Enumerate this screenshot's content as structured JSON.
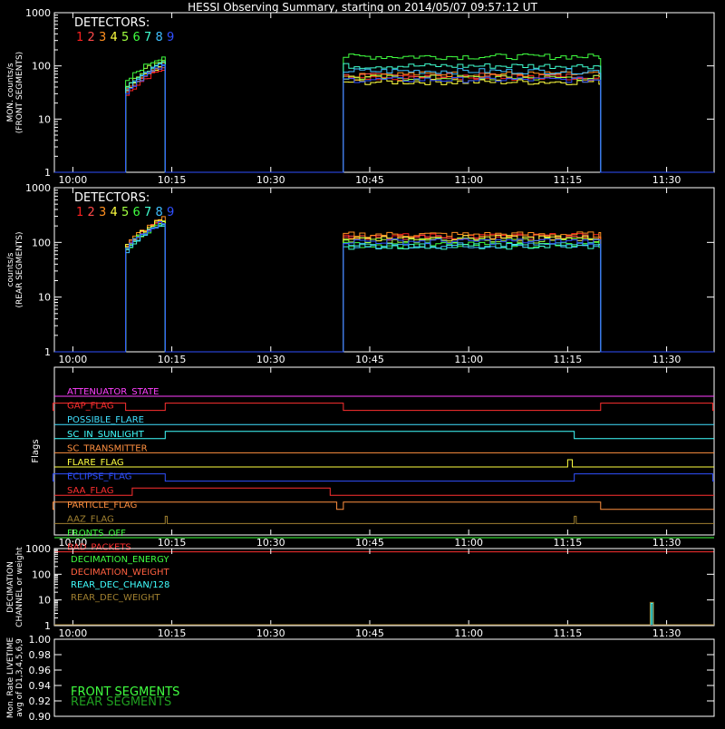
{
  "title": "HESSI Observing Summary, starting on 2014/05/07 09:57:12 UT",
  "colors": {
    "background": "#000000",
    "axes": "#ffffff",
    "det1": "#ff2020",
    "det2": "#ff4a4a",
    "det3": "#ff9020",
    "det4": "#ffff40",
    "det5": "#a0ff40",
    "det6": "#40ff40",
    "det7": "#40ffd0",
    "det8": "#40c0ff",
    "det9": "#3050ff"
  },
  "chart_data": [
    {
      "type": "line",
      "panel": "front",
      "ylabel": "MON. counts/s\n(FRONT SEGMENTS)",
      "yscale": "log",
      "ylim": [
        1,
        1000
      ],
      "yticks": [
        "1",
        "10",
        "100",
        "1000"
      ],
      "xticks": [
        "10:00",
        "10:15",
        "10:30",
        "10:45",
        "11:00",
        "11:15",
        "11:30"
      ],
      "legend_title": "DETECTORS:",
      "legend": [
        "1",
        "2",
        "3",
        "4",
        "5",
        "6",
        "7",
        "8",
        "9"
      ],
      "obs_windows": [
        [
          "10:08",
          "10:14"
        ],
        [
          "10:41",
          "11:20"
        ]
      ],
      "series": [
        {
          "name": "1",
          "color": "#ff2020",
          "levels": [
            40,
            60
          ]
        },
        {
          "name": "2",
          "color": "#ff4a4a",
          "levels": [
            45,
            65
          ]
        },
        {
          "name": "3",
          "color": "#ff9020",
          "levels": [
            50,
            70
          ]
        },
        {
          "name": "4",
          "color": "#ffff40",
          "levels": [
            45,
            50
          ]
        },
        {
          "name": "5",
          "color": "#a0ff40",
          "levels": [
            60,
            60
          ]
        },
        {
          "name": "6",
          "color": "#40ff40",
          "levels": [
            70,
            150
          ]
        },
        {
          "name": "7",
          "color": "#40ffd0",
          "levels": [
            55,
            100
          ]
        },
        {
          "name": "8",
          "color": "#40c0ff",
          "levels": [
            50,
            80
          ]
        },
        {
          "name": "9",
          "color": "#3050ff",
          "levels": [
            45,
            55
          ]
        }
      ]
    },
    {
      "type": "line",
      "panel": "rear",
      "ylabel": "counts/s\n(REAR SEGMENTS)",
      "yscale": "log",
      "ylim": [
        1,
        1000
      ],
      "yticks": [
        "1",
        "10",
        "100",
        "1000"
      ],
      "xticks": [
        "10:00",
        "10:15",
        "10:30",
        "10:45",
        "11:00",
        "11:15",
        "11:30"
      ],
      "legend_title": "DETECTORS:",
      "legend": [
        "1",
        "2",
        "3",
        "4",
        "5",
        "6",
        "7",
        "8",
        "9"
      ],
      "obs_windows": [
        [
          "10:08",
          "10:14"
        ],
        [
          "10:41",
          "11:20"
        ]
      ],
      "series": [
        {
          "name": "1",
          "color": "#ff2020",
          "levels": [
            120,
            130
          ]
        },
        {
          "name": "2",
          "color": "#ff4a4a",
          "levels": [
            115,
            125
          ]
        },
        {
          "name": "3",
          "color": "#ff9020",
          "levels": [
            125,
            140
          ]
        },
        {
          "name": "4",
          "color": "#ffff40",
          "levels": [
            120,
            120
          ]
        },
        {
          "name": "5",
          "color": "#a0ff40",
          "levels": [
            110,
            110
          ]
        },
        {
          "name": "6",
          "color": "#40ff40",
          "levels": [
            105,
            90
          ]
        },
        {
          "name": "7",
          "color": "#40ffd0",
          "levels": [
            100,
            85
          ]
        },
        {
          "name": "8",
          "color": "#40c0ff",
          "levels": [
            100,
            88
          ]
        },
        {
          "name": "9",
          "color": "#3050ff",
          "levels": [
            110,
            105
          ]
        }
      ]
    },
    {
      "type": "line",
      "panel": "flags",
      "ylabel": "Flags",
      "xticks": [
        "10:00",
        "10:15",
        "10:30",
        "10:45",
        "11:00",
        "11:15",
        "11:30"
      ],
      "flags": [
        {
          "name": "ATTENUATOR_STATE",
          "color": "#ff40ff",
          "high": []
        },
        {
          "name": "GAP_FLAG",
          "color": "#ff3030",
          "high": [
            [
              "09:57",
              "10:08"
            ],
            [
              "10:14",
              "10:41"
            ],
            [
              "11:20",
              "11:37"
            ]
          ]
        },
        {
          "name": "POSSIBLE_FLARE",
          "color": "#40e0ff",
          "high": []
        },
        {
          "name": "SC_IN_SUNLIGHT",
          "color": "#40ffff",
          "high": [
            [
              "10:14",
              "11:16"
            ]
          ]
        },
        {
          "name": "SC_TRANSMITTER",
          "color": "#ff9040",
          "high": []
        },
        {
          "name": "FLARE_FLAG",
          "color": "#ffff40",
          "high": [
            [
              "11:15",
              "11:15.7"
            ]
          ]
        },
        {
          "name": "ECLIPSE_FLAG",
          "color": "#3050ff",
          "high": [
            [
              "09:57",
              "10:14"
            ],
            [
              "11:16",
              "11:37"
            ]
          ]
        },
        {
          "name": "SAA_FLAG",
          "color": "#ff3030",
          "high": [
            [
              "10:09",
              "10:39"
            ]
          ]
        },
        {
          "name": "PARTICLE_FLAG",
          "color": "#ff9040",
          "high": [
            [
              "09:57",
              "10:40"
            ],
            [
              "10:41",
              "11:20"
            ]
          ]
        },
        {
          "name": "AAZ_FLAG",
          "color": "#a08030",
          "high": [
            [
              "10:14",
              "10:14.3"
            ],
            [
              "11:16",
              "11:16.3"
            ]
          ]
        },
        {
          "name": "FRONTS_OFF",
          "color": "#40ff40",
          "high": []
        },
        {
          "name": "BAD_PACKETS",
          "color": "#ff3030",
          "high": []
        }
      ]
    },
    {
      "type": "line",
      "panel": "decimation",
      "ylabel": "DECIMATION\nCHANNEL or weight",
      "yscale": "log",
      "ylim": [
        1,
        1000
      ],
      "yticks": [
        "1",
        "10",
        "100",
        "1000"
      ],
      "xticks": [
        "10:00",
        "10:15",
        "10:30",
        "10:45",
        "11:00",
        "11:15",
        "11:30"
      ],
      "legend": [
        {
          "name": "DECIMATION_ENERGY",
          "color": "#40ff40"
        },
        {
          "name": "DECIMATION_WEIGHT",
          "color": "#ff6040"
        },
        {
          "name": "REAR_DEC_CHAN/128",
          "color": "#40ffff"
        },
        {
          "name": "REAR_DEC_WEIGHT",
          "color": "#a08030"
        }
      ],
      "pulse": {
        "start": "11:27.5",
        "end": "11:28",
        "value": 8
      }
    },
    {
      "type": "line",
      "panel": "livetime",
      "ylabel": "Mon. Rate LIVETIME\navg of D1,3,4,5,6,9",
      "ylim": [
        0.9,
        1.0
      ],
      "yticks": [
        "0.90",
        "0.92",
        "0.94",
        "0.96",
        "0.98",
        "1.00"
      ],
      "legend": [
        {
          "name": "FRONT SEGMENTS",
          "color": "#40ff40"
        },
        {
          "name": "REAR SEGMENTS",
          "color": "#20a020"
        }
      ]
    }
  ]
}
